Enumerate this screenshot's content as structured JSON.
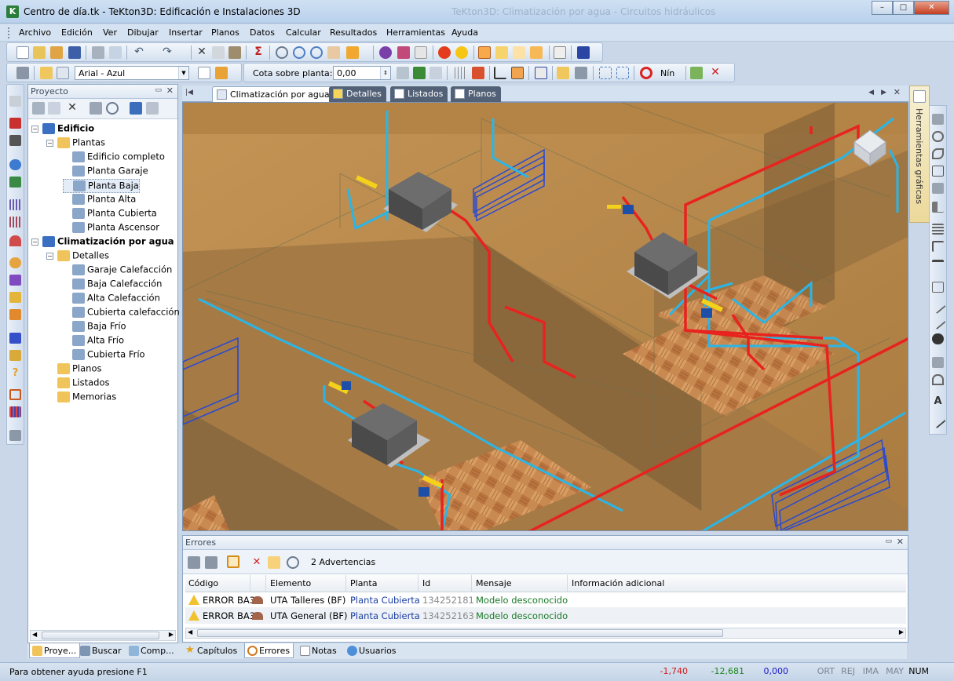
{
  "window": {
    "title": "Centro de día.tk - TeKton3D: Edificación e Instalaciones 3D",
    "ghost_title": "TeKton3D: Climatización por agua - Circuitos hidráulicos",
    "minimize": "–",
    "maximize": "□",
    "close": "✕"
  },
  "menu": [
    "Archivo",
    "Edición",
    "Ver",
    "Dibujar",
    "Insertar",
    "Planos",
    "Datos",
    "Calcular",
    "Resultados",
    "Herramientas",
    "Ayuda"
  ],
  "toolbar2": {
    "style_value": "Arial - Azul",
    "cota_label": "Cota sobre planta:",
    "cota_value": "0,00",
    "nin_label": "Nín"
  },
  "project_panel": {
    "title": "Proyecto",
    "pin": "▭",
    "close": "✕",
    "tree": [
      {
        "label": "Edificio",
        "bold": true,
        "level": 0
      },
      {
        "label": "Plantas",
        "level": 1
      },
      {
        "label": "Edificio completo",
        "level": 2
      },
      {
        "label": "Planta Garaje",
        "level": 2
      },
      {
        "label": "Planta Baja",
        "level": 2,
        "selected": true
      },
      {
        "label": "Planta Alta",
        "level": 2
      },
      {
        "label": "Planta Cubierta",
        "level": 2
      },
      {
        "label": "Planta Ascensor",
        "level": 2
      },
      {
        "label": "Climatización por agua",
        "bold": true,
        "level": 0
      },
      {
        "label": "Detalles",
        "level": 1
      },
      {
        "label": "Garaje Calefacción",
        "level": 2
      },
      {
        "label": "Baja Calefacción",
        "level": 2
      },
      {
        "label": "Alta Calefacción",
        "level": 2
      },
      {
        "label": "Cubierta calefacción",
        "level": 2
      },
      {
        "label": "Baja Frío",
        "level": 2
      },
      {
        "label": "Alta Frío",
        "level": 2
      },
      {
        "label": "Cubierta Frío",
        "level": 2
      },
      {
        "label": "Planos",
        "level": 1
      },
      {
        "label": "Listados",
        "level": 1
      },
      {
        "label": "Memorias",
        "level": 1
      }
    ]
  },
  "doc_tabs": [
    "Climatización por agua",
    "Detalles",
    "Listados",
    "Planos"
  ],
  "side_tab": "Herramientas gráficas",
  "errors_panel": {
    "title": "Errores",
    "count_label": "2 Advertencias",
    "columns": [
      "Código",
      "Elemento",
      "Planta",
      "Id",
      "Mensaje",
      "Información adicional"
    ],
    "rows": [
      {
        "code": "ERROR BA3",
        "element": "UTA Talleres (BF)",
        "floor": "Planta Cubierta",
        "id": "134252181",
        "message": "Modelo desconocido",
        "info": ""
      },
      {
        "code": "ERROR BA3",
        "element": "UTA General (BF)",
        "floor": "Planta Cubierta",
        "id": "134252163",
        "message": "Modelo desconocido",
        "info": ""
      }
    ]
  },
  "bottom_tabs": [
    "Proye...",
    "Buscar",
    "Comp...",
    "Capítulos",
    "Errores",
    "Notas",
    "Usuarios"
  ],
  "status": {
    "help": "Para obtener ayuda presione F1",
    "x": "-1,740",
    "y": "-12,681",
    "z": "0,000",
    "ort": "ORT",
    "rej": "REJ",
    "ima": "IMA",
    "may": "MAY",
    "num": "NUM"
  },
  "colors": {
    "accent": "#2a7d3b",
    "hot_pipe": "#e8231f",
    "cold_pipe": "#2bb5e6",
    "wood": "#b0844a"
  }
}
